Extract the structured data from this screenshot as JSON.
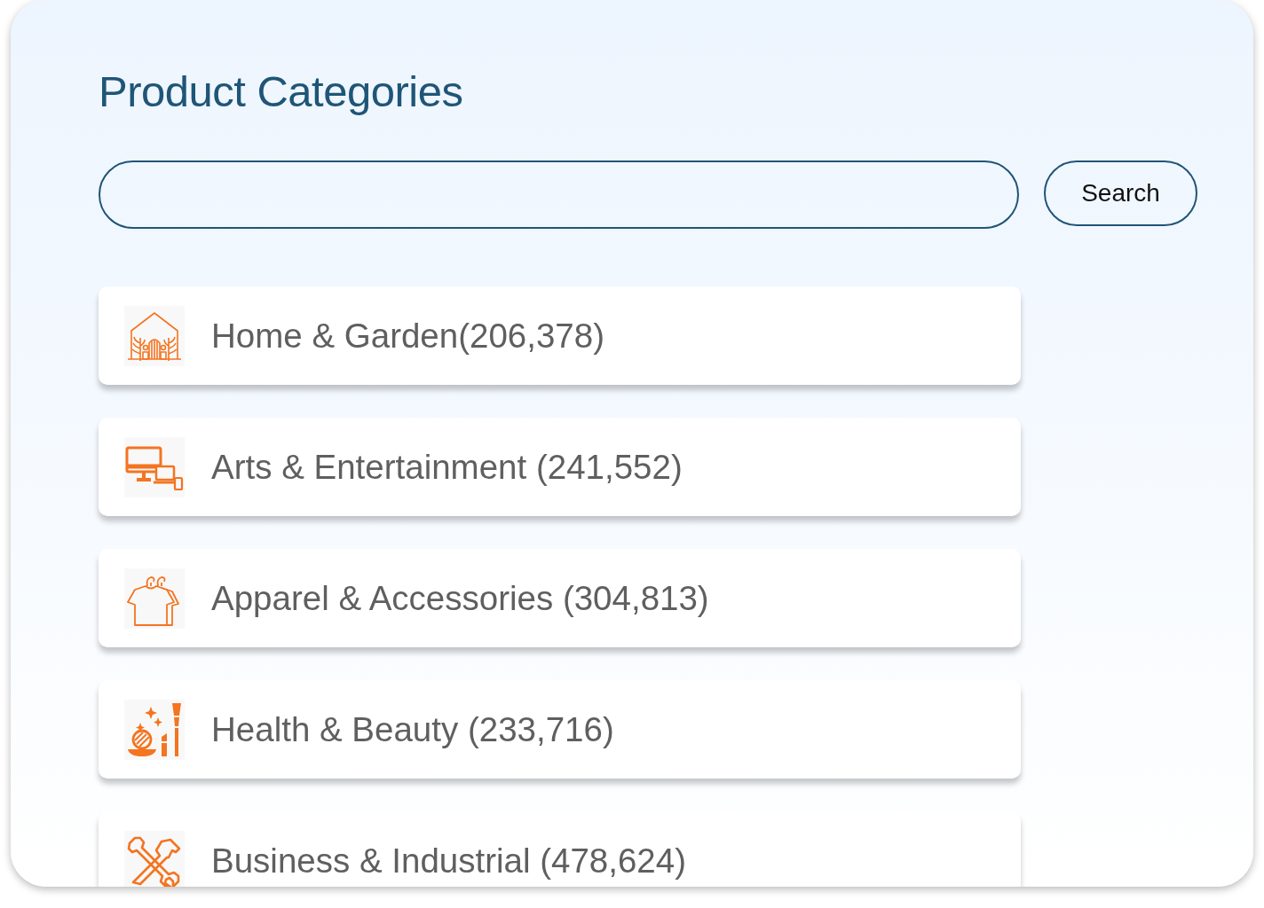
{
  "title": "Product Categories",
  "search": {
    "button": "Search"
  },
  "categories": [
    {
      "label": "Home & Garden(206,378)"
    },
    {
      "label": "Arts & Entertainment (241,552)"
    },
    {
      "label": "Apparel & Accessories (304,813)"
    },
    {
      "label": "Health & Beauty (233,716)"
    },
    {
      "label": "Business & Industrial (478,624)"
    }
  ]
}
